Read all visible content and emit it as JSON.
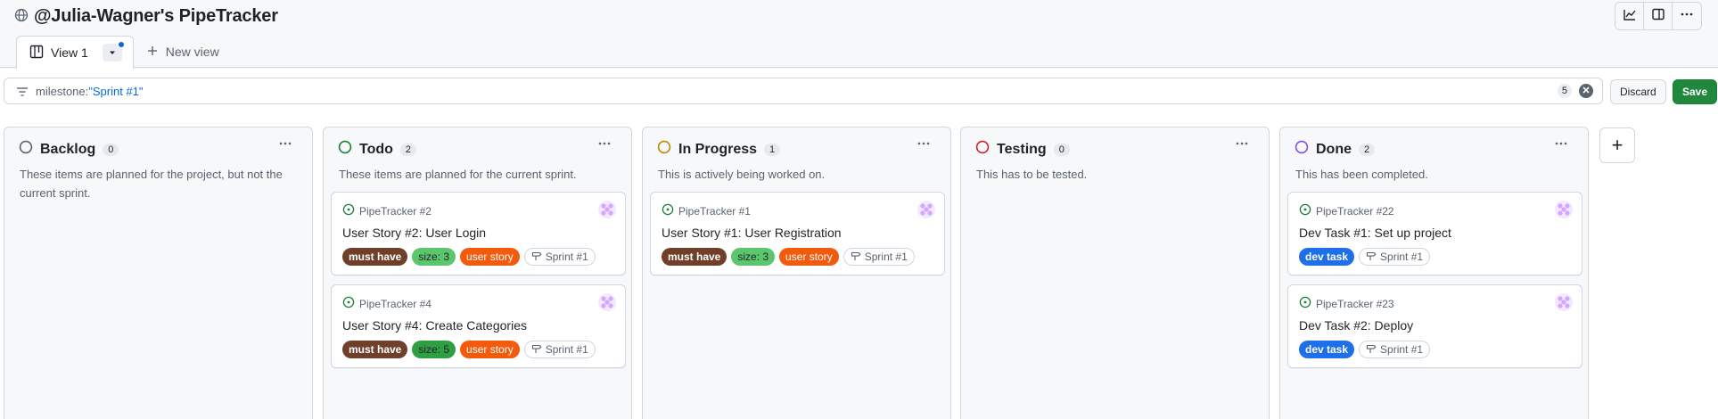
{
  "header": {
    "title": "@Julia-Wagner's PipeTracker",
    "icons": [
      "globe-icon",
      "graph-icon",
      "sidebar-icon",
      "kebab-icon"
    ]
  },
  "tabs": {
    "active_label": "View 1",
    "new_view_label": "New view"
  },
  "filter": {
    "key": "milestone:",
    "value": "\"Sprint #1\"",
    "result_count": "5",
    "discard_label": "Discard",
    "save_label": "Save"
  },
  "colors": {
    "backlog": "#59636e",
    "todo": "#1a7f37",
    "in_progress": "#bf8700",
    "testing": "#cf222e",
    "done": "#8250df",
    "issue_open": "#1a7f37"
  },
  "columns": [
    {
      "name": "Backlog",
      "count": "0",
      "description": "These items are planned for the project, but not the current sprint.",
      "cards": []
    },
    {
      "name": "Todo",
      "count": "2",
      "description": "These items are planned for the current sprint.",
      "cards": [
        {
          "ref": "PipeTracker #2",
          "title": "User Story #2: User Login",
          "labels": [
            "must have",
            "size: 3",
            "user story"
          ],
          "milestone": "Sprint #1"
        },
        {
          "ref": "PipeTracker #4",
          "title": "User Story #4: Create Categories",
          "labels": [
            "must have",
            "size: 5",
            "user story"
          ],
          "milestone": "Sprint #1"
        }
      ]
    },
    {
      "name": "In Progress",
      "count": "1",
      "description": "This is actively being worked on.",
      "cards": [
        {
          "ref": "PipeTracker #1",
          "title": "User Story #1: User Registration",
          "labels": [
            "must have",
            "size: 3",
            "user story"
          ],
          "milestone": "Sprint #1"
        }
      ]
    },
    {
      "name": "Testing",
      "count": "0",
      "description": "This has to be tested.",
      "cards": []
    },
    {
      "name": "Done",
      "count": "2",
      "description": "This has been completed.",
      "cards": [
        {
          "ref": "PipeTracker #22",
          "title": "Dev Task #1: Set up project",
          "labels": [
            "dev task"
          ],
          "milestone": "Sprint #1"
        },
        {
          "ref": "PipeTracker #23",
          "title": "Dev Task #2: Deploy",
          "labels": [
            "dev task"
          ],
          "milestone": "Sprint #1"
        }
      ]
    }
  ],
  "add_column_label": "+"
}
